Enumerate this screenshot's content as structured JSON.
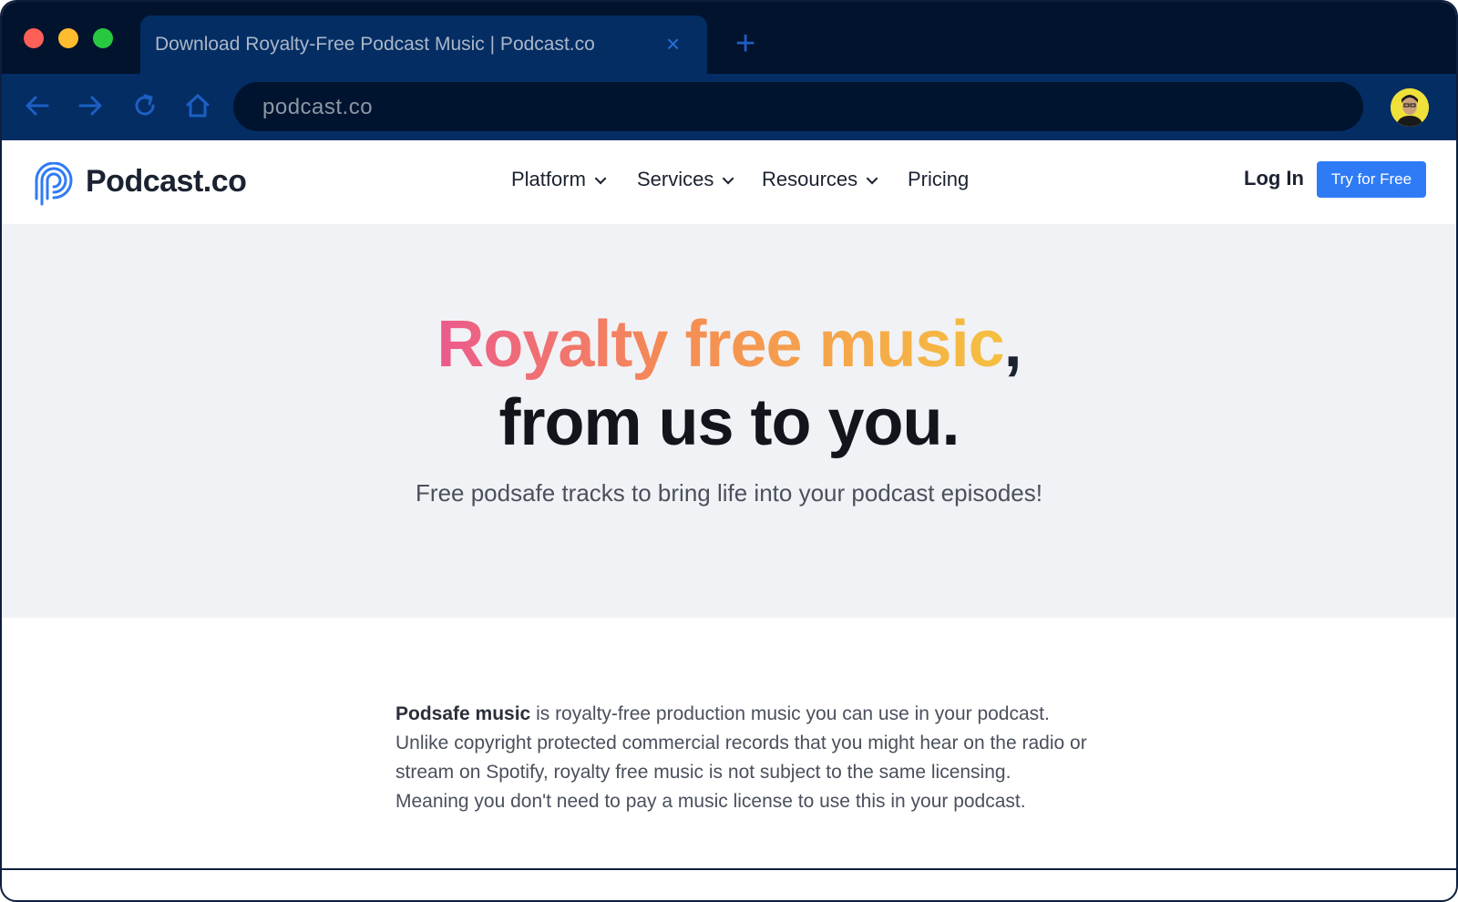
{
  "browser": {
    "tab_title": "Download Royalty-Free Podcast Music | Podcast.co",
    "tab_close": "×",
    "new_tab": "+",
    "url": "podcast.co"
  },
  "site": {
    "logo_text": "Podcast.co",
    "nav": [
      {
        "label": "Platform"
      },
      {
        "label": "Services"
      },
      {
        "label": "Resources"
      },
      {
        "label": "Pricing"
      }
    ],
    "login_label": "Log In",
    "cta_label": "Try for Free"
  },
  "hero": {
    "headline_colored": "Royalty free music",
    "headline_comma": ",",
    "headline_line2": "from us to you.",
    "subtitle": "Free podsafe tracks to bring life into your podcast episodes!"
  },
  "intro": {
    "bold_term": "Podsafe music",
    "text": " is royalty-free production music you can use in your podcast. Unlike copyright protected commercial records that you might hear on the radio or stream on Spotify, royalty free music is not subject to the same licensing. Meaning you don't need to pay a music license to use this in your podcast."
  },
  "colors": {
    "accent": "#2f7bf5",
    "gradient_start": "#ec5a8c",
    "gradient_end": "#f5c040",
    "chrome_dark": "#02132e",
    "chrome_mid": "#042d63"
  }
}
